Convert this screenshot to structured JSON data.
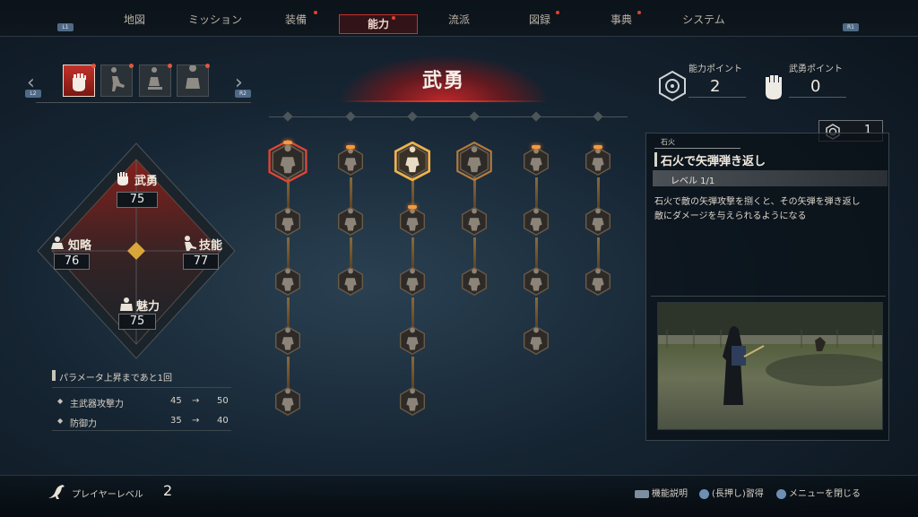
{
  "nav": {
    "l1": "L1",
    "r1": "R1",
    "tabs": [
      {
        "label": "地図"
      },
      {
        "label": "ミッション"
      },
      {
        "label": "装備"
      },
      {
        "label": "能力"
      },
      {
        "label": "流派"
      },
      {
        "label": "図録"
      },
      {
        "label": "事典"
      },
      {
        "label": "システム"
      }
    ]
  },
  "category": {
    "l2": "L2",
    "r2": "R2",
    "left_arrow": "‹",
    "right_arrow": "›"
  },
  "banner": {
    "title": "武勇"
  },
  "points": {
    "ability": {
      "label": "能力ポイント",
      "value": "2"
    },
    "valor": {
      "label": "武勇ポイント",
      "value": "0"
    }
  },
  "stats": {
    "buyu": {
      "label": "武勇",
      "value": "75"
    },
    "chiryaku": {
      "label": "知略",
      "value": "76"
    },
    "gino": {
      "label": "技能",
      "value": "77"
    },
    "miryoku": {
      "label": "魅力",
      "value": "75"
    }
  },
  "param": {
    "title": "パラメータ上昇まであと1回",
    "rows": [
      {
        "name": "主武器攻撃力",
        "from": "45",
        "arrow": "→",
        "to": "50"
      },
      {
        "name": "防御力",
        "from": "35",
        "arrow": "→",
        "to": "40"
      }
    ]
  },
  "detail": {
    "cost": "1",
    "category": "石火",
    "title": "石火で矢弾弾き返し",
    "level": "レベル 1/1",
    "desc_line1": "石火で敵の矢弾攻撃を捌くと、その矢弾を弾き返し",
    "desc_line2": "敵にダメージを与えられるようになる"
  },
  "footer": {
    "player_level_label": "プレイヤーレベル",
    "player_level": "2",
    "hint1": "機能説明",
    "hint2": "(長押し)習得",
    "hint3": "メニューを閉じる"
  },
  "colors": {
    "accent_red": "#c8332a",
    "node_gold": "#d9a14a",
    "notify": "#e0422f"
  }
}
